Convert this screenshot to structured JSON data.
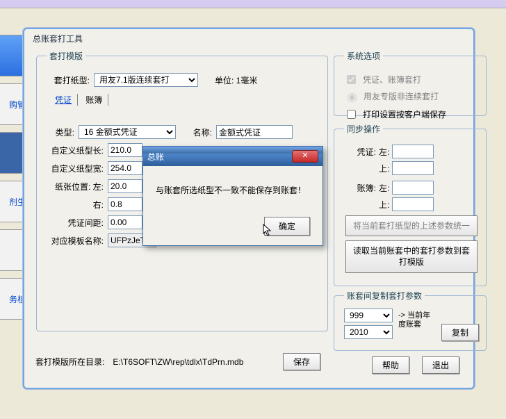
{
  "window": {
    "title": "总账套打工具"
  },
  "template_group": {
    "legend": "套打模版",
    "paper_label": "套打纸型:",
    "paper_value": "用友7.1版连续套打",
    "unit_label": "单位: 1毫米",
    "tabs": {
      "voucher": "凭证",
      "book": "账簿"
    },
    "type_label": "类型:",
    "type_value": "16 金额式凭证",
    "name_label": "名称:",
    "name_value": "金额式凭证",
    "custom_len_label": "自定义纸型长:",
    "custom_len_value": "210.0",
    "custom_wid_label": "自定义纸型宽:",
    "custom_wid_value": "254.0",
    "pos_left_label": "纸张位置: 左:",
    "pos_left_value": "20.0",
    "pos_right_label": "右:",
    "pos_right_value": "0.8",
    "gap_label": "凭证间距:",
    "gap_value": "0.00",
    "tmpl_name_label": "对应模板名称:",
    "tmpl_name_value": "UFPzJeTd"
  },
  "sysopt": {
    "legend": "系统选项",
    "opt_voucher_book": "凭证、账簿套打",
    "opt_nonserial": "用友专版非连续套打",
    "opt_save_client": "打印设置按客户端保存"
  },
  "sync": {
    "legend": "同步操作",
    "voucher_label": "凭证:",
    "book_label": "账簿:",
    "left_label": "左:",
    "top_label": "上:",
    "values": {
      "v_left": "",
      "v_top": "",
      "b_left": "",
      "b_top": ""
    },
    "bigbtn1": "将当前套打纸型的上述参数统一",
    "bigbtn2": "读取当前账套中的套打参数到套打模版"
  },
  "copy": {
    "legend": "账套间复制套打参数",
    "acct_value": "999",
    "year_value": "2010",
    "arrow_label": "-> 当前年度账套",
    "copy_btn": "复制"
  },
  "bottom": {
    "dir_label": "套打模版所在目录:",
    "dir_value": "E:\\T6SOFT\\ZW\\rep\\tdlx\\TdPrn.mdb",
    "save_btn": "保存",
    "help_btn": "帮助",
    "exit_btn": "退出"
  },
  "modal": {
    "title": "总账",
    "message": "与账套所选纸型不一致不能保存到账套！",
    "ok": "确定",
    "close_glyph": "✕"
  },
  "left_fragments": [
    "",
    "购管",
    "",
    "剂生",
    "",
    "务核"
  ]
}
